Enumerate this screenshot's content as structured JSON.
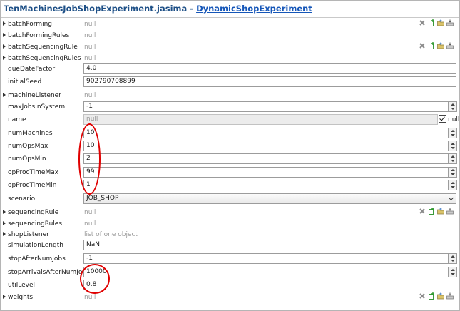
{
  "header": {
    "file_name": "TenMachinesJobShopExperiment.jasima",
    "separator": " - ",
    "link_label": "DynamicShopExperiment"
  },
  "rows": {
    "batchForming": {
      "label": "batchForming",
      "value": "null"
    },
    "batchFormingRules": {
      "label": "batchFormingRules",
      "value": "null"
    },
    "batchSequencingRule": {
      "label": "batchSequencingRule",
      "value": "null"
    },
    "batchSequencingRules": {
      "label": "batchSequencingRules",
      "value": "null"
    },
    "dueDateFactor": {
      "label": "dueDateFactor",
      "value": "4.0"
    },
    "initialSeed": {
      "label": "initialSeed",
      "value": "902790708899"
    },
    "machineListener": {
      "label": "machineListener",
      "value": "null"
    },
    "maxJobsInSystem": {
      "label": "maxJobsInSystem",
      "value": "-1"
    },
    "name": {
      "label": "name",
      "value": "null",
      "checkbox_label": "null",
      "checkbox_checked": true
    },
    "numMachines": {
      "label": "numMachines",
      "value": "10"
    },
    "numOpsMax": {
      "label": "numOpsMax",
      "value": "10"
    },
    "numOpsMin": {
      "label": "numOpsMin",
      "value": "2"
    },
    "opProcTimeMax": {
      "label": "opProcTimeMax",
      "value": "99"
    },
    "opProcTimeMin": {
      "label": "opProcTimeMin",
      "value": "1"
    },
    "scenario": {
      "label": "scenario",
      "value": "JOB_SHOP"
    },
    "sequencingRule": {
      "label": "sequencingRule",
      "value": "null"
    },
    "sequencingRules": {
      "label": "sequencingRules",
      "value": "null"
    },
    "shopListener": {
      "label": "shopListener",
      "value": "list of one object"
    },
    "simulationLength": {
      "label": "simulationLength",
      "value": "NaN"
    },
    "stopAfterNumJobs": {
      "label": "stopAfterNumJobs",
      "value": "-1"
    },
    "stopArrivalsAfterNumJobs": {
      "label": "stopArrivalsAfterNumJobs",
      "value": "10000"
    },
    "utilLevel": {
      "label": "utilLevel",
      "value": "0.8"
    },
    "weights": {
      "label": "weights",
      "value": "null"
    }
  },
  "icons": [
    "delete-icon",
    "new-icon",
    "open-icon",
    "save-icon"
  ],
  "colors": {
    "highlight_circle": "#e00000",
    "link": "#1556b8",
    "title": "#1d4f86"
  }
}
